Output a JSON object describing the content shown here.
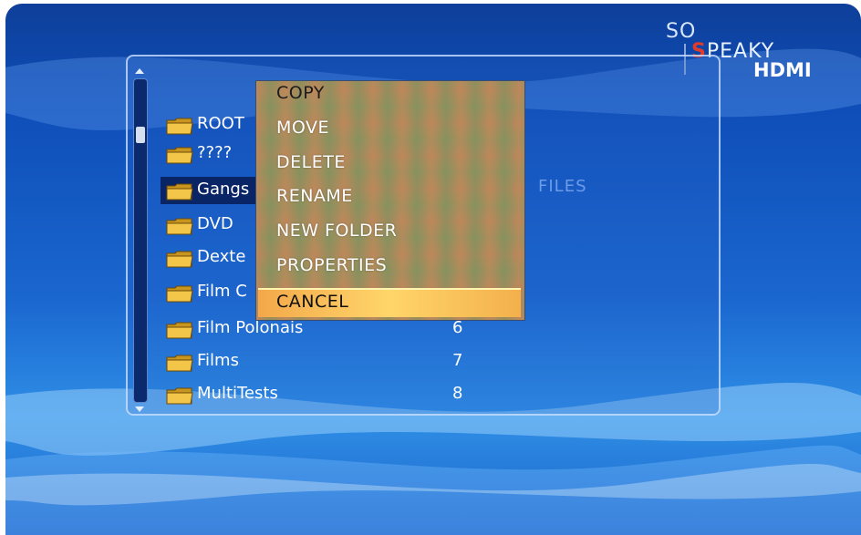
{
  "logo": {
    "line1": "SO",
    "line2_s": "S",
    "line2_rest": "PEAKY",
    "line3": "HDMI"
  },
  "file_list": [
    {
      "name": "ROOT",
      "num": ""
    },
    {
      "name": "????",
      "num": ""
    },
    {
      "name": "Gangs",
      "num": ""
    },
    {
      "name": "DVD",
      "num": ""
    },
    {
      "name": "Dexte",
      "num": ""
    },
    {
      "name": "Film C",
      "num": ""
    },
    {
      "name": "Film Polonais",
      "num": "6"
    },
    {
      "name": "Films",
      "num": "7"
    },
    {
      "name": "MultiTests",
      "num": "8"
    }
  ],
  "selected_index": 2,
  "files_label": "FILES",
  "context_menu": {
    "items": [
      "COPY",
      "MOVE",
      "DELETE",
      "RENAME",
      "NEW FOLDER",
      "PROPERTIES"
    ],
    "cancel": "CANCEL"
  }
}
